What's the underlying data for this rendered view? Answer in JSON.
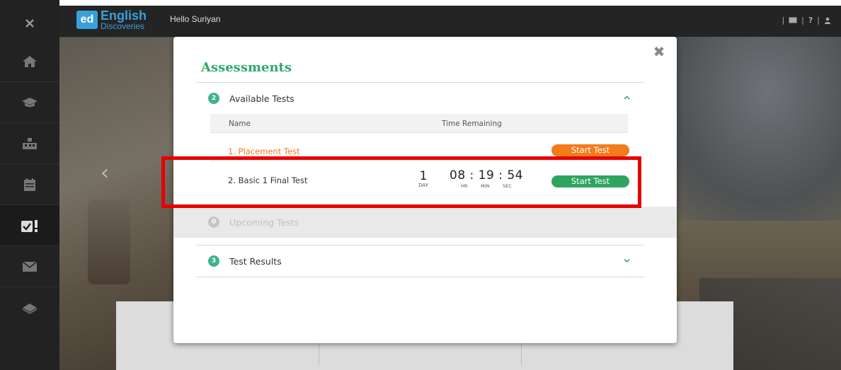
{
  "app": {
    "brand_line1": "English",
    "brand_line2": "Discoveries",
    "brand_abbr": "ed",
    "greeting": "Hello Suriyan"
  },
  "topbar": {
    "icons": [
      "mail-icon",
      "help-icon",
      "user-icon"
    ],
    "help_glyph": "?",
    "separator": "|"
  },
  "sidebar": {
    "items": [
      "close-icon",
      "home-icon",
      "course-icon",
      "classroom-icon",
      "calendar-icon",
      "assessments-icon",
      "messages-icon",
      "library-icon"
    ]
  },
  "modal": {
    "title": "Assessments",
    "close_glyph": "✖",
    "available": {
      "count": "2",
      "label": "Available Tests",
      "col_name": "Name",
      "col_time": "Time Remaining",
      "tests": [
        {
          "name": "1. Placement Test",
          "button": "Start Test"
        },
        {
          "name": "2. Basic 1 Final Test",
          "days": "1",
          "days_label": "DAY",
          "clock": "08 : 19 : 54",
          "hr_label": "HR",
          "min_label": "MIN",
          "sec_label": "SEC",
          "button": "Start Test"
        }
      ]
    },
    "upcoming": {
      "count": "0",
      "label": "Upcoming Tests"
    },
    "results": {
      "count": "3",
      "label": "Test Results"
    }
  },
  "colors": {
    "accent_green": "#2fa86a",
    "start_orange": "#f27c1b",
    "start_green": "#2ea45e",
    "highlight_red": "#e60000",
    "brand_blue": "#3aa0dc"
  }
}
